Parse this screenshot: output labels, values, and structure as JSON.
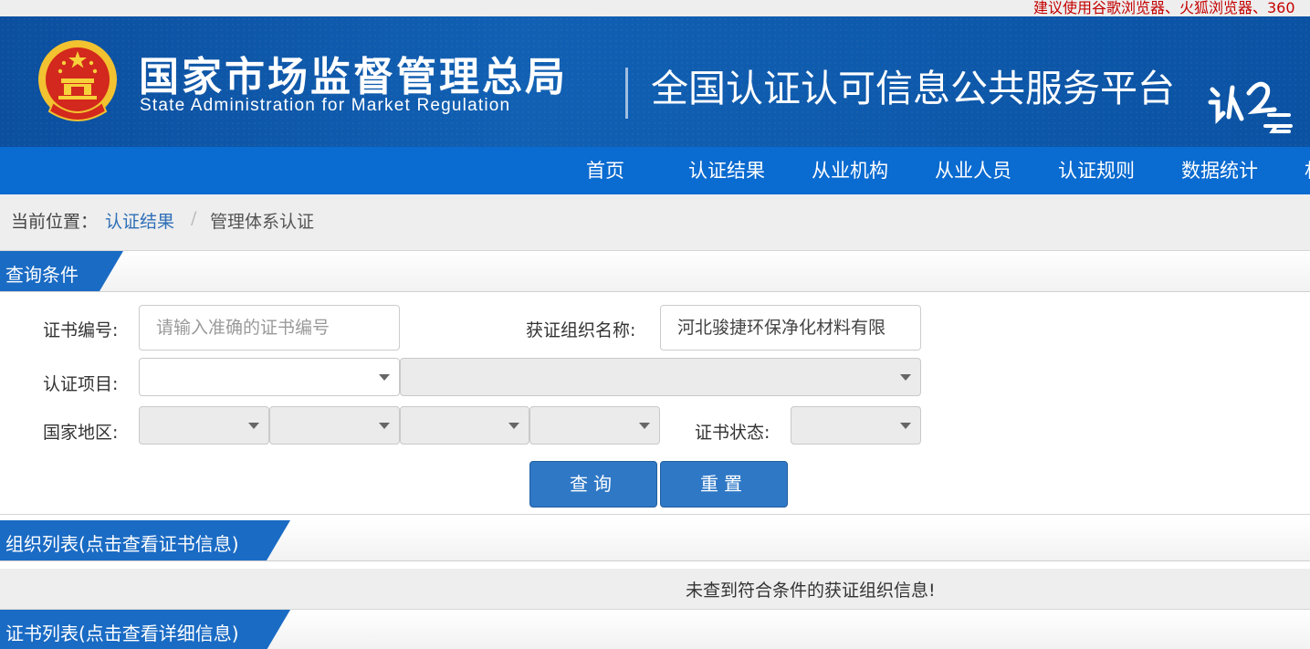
{
  "top_notice": "建议使用谷歌浏览器、火狐浏览器、360",
  "header": {
    "agency_cn": "国家市场监督管理总局",
    "agency_en": "State Administration  for  Market Regulation",
    "platform_title": "全国认证认可信息公共服务平台",
    "logo_text": "认云"
  },
  "nav": {
    "items": [
      "首页",
      "认证结果",
      "从业机构",
      "从业人员",
      "认证规则",
      "数据统计",
      "村"
    ]
  },
  "breadcrumb": {
    "prefix": "当前位置：",
    "link": "认证结果",
    "separator": "/",
    "current": "管理体系认证"
  },
  "query_section": {
    "title": "查询条件"
  },
  "form": {
    "cert_no_label": "证书编号:",
    "cert_no_placeholder": "请输入准确的证书编号",
    "org_name_label": "获证组织名称:",
    "org_name_value": "河北骏捷环保净化材料有限",
    "cert_project_label": "认证项目:",
    "region_label": "国家地区:",
    "cert_status_label": "证书状态:",
    "search_button": "查询",
    "reset_button": "重置"
  },
  "org_list": {
    "title": "组织列表(点击查看证书信息)",
    "empty_message": "未查到符合条件的获证组织信息!"
  },
  "cert_list": {
    "title": "证书列表(点击查看详细信息)"
  },
  "colors": {
    "header_blue": "#0d56a8",
    "nav_blue": "#0a6bd0",
    "button_blue": "#2f78c6",
    "tab_blue": "#1a6bc4",
    "notice_red": "#c40000"
  }
}
